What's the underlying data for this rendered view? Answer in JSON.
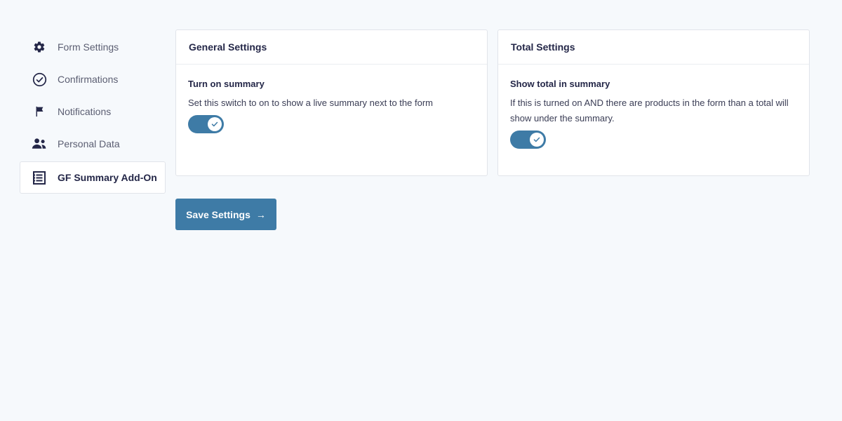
{
  "sidebar": {
    "items": [
      {
        "label": "Form Settings",
        "icon": "gear-icon"
      },
      {
        "label": "Confirmations",
        "icon": "check-circle-icon"
      },
      {
        "label": "Notifications",
        "icon": "flag-icon"
      },
      {
        "label": "Personal Data",
        "icon": "users-icon"
      },
      {
        "label": "GF Summary Add-On",
        "icon": "list-icon",
        "active": true
      }
    ]
  },
  "general_settings": {
    "title": "General Settings",
    "field_label": "Turn on summary",
    "field_description": "Set this switch to on to show a live summary next to the form",
    "toggle_on": true
  },
  "total_settings": {
    "title": "Total Settings",
    "field_label": "Show total in summary",
    "field_description": "If this is turned on AND there are products in the form than a total will show under the summary.",
    "toggle_on": true
  },
  "save_button": {
    "label": "Save Settings",
    "arrow": "→"
  },
  "colors": {
    "accent": "#3e7ba6",
    "background": "#f6f9fc",
    "text": "#242748"
  }
}
